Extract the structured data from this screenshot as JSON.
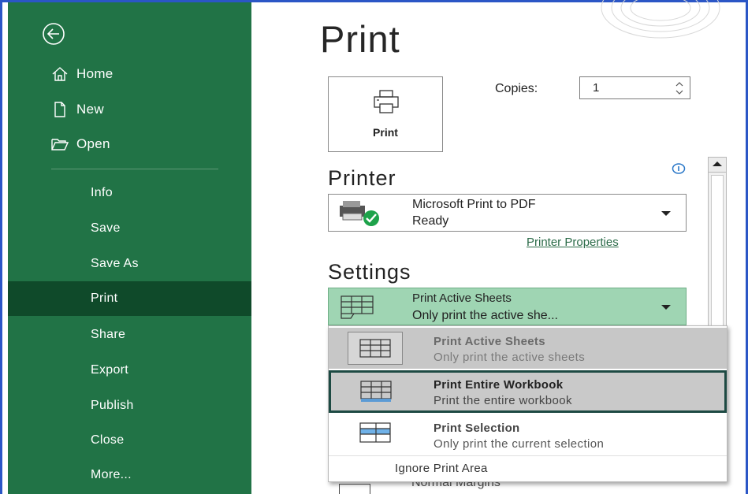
{
  "sidebar": {
    "items": [
      {
        "label": "Home",
        "icon": "home-icon"
      },
      {
        "label": "New",
        "icon": "new-document-icon"
      },
      {
        "label": "Open",
        "icon": "open-folder-icon"
      },
      {
        "label": "Info"
      },
      {
        "label": "Save"
      },
      {
        "label": "Save As"
      },
      {
        "label": "Print",
        "active": true
      },
      {
        "label": "Share"
      },
      {
        "label": "Export"
      },
      {
        "label": "Publish"
      },
      {
        "label": "Close"
      },
      {
        "label": "More..."
      }
    ]
  },
  "main": {
    "title": "Print",
    "print_button_label": "Print",
    "copies_label": "Copies:",
    "copies_value": "1",
    "printer": {
      "heading": "Printer",
      "name": "Microsoft Print to PDF",
      "status": "Ready",
      "properties_link": "Printer Properties"
    },
    "settings": {
      "heading": "Settings",
      "selected_title": "Print Active Sheets",
      "selected_sub": "Only print the active she...",
      "options": [
        {
          "title": "Print Active Sheets",
          "sub": "Only print the active sheets"
        },
        {
          "title": "Print Entire Workbook",
          "sub": "Print the entire workbook"
        },
        {
          "title": "Print Selection",
          "sub": "Only print the current selection"
        }
      ],
      "ignore_print_area": "Ignore Print Area",
      "next_setting_peek": "Normal Margins"
    }
  },
  "colors": {
    "sidebar_bg": "#217346",
    "sidebar_active": "#0f4a2a",
    "selected_setting_bg": "#9fd5b3",
    "frame": "#2b56c6",
    "link": "#2b6b48"
  }
}
